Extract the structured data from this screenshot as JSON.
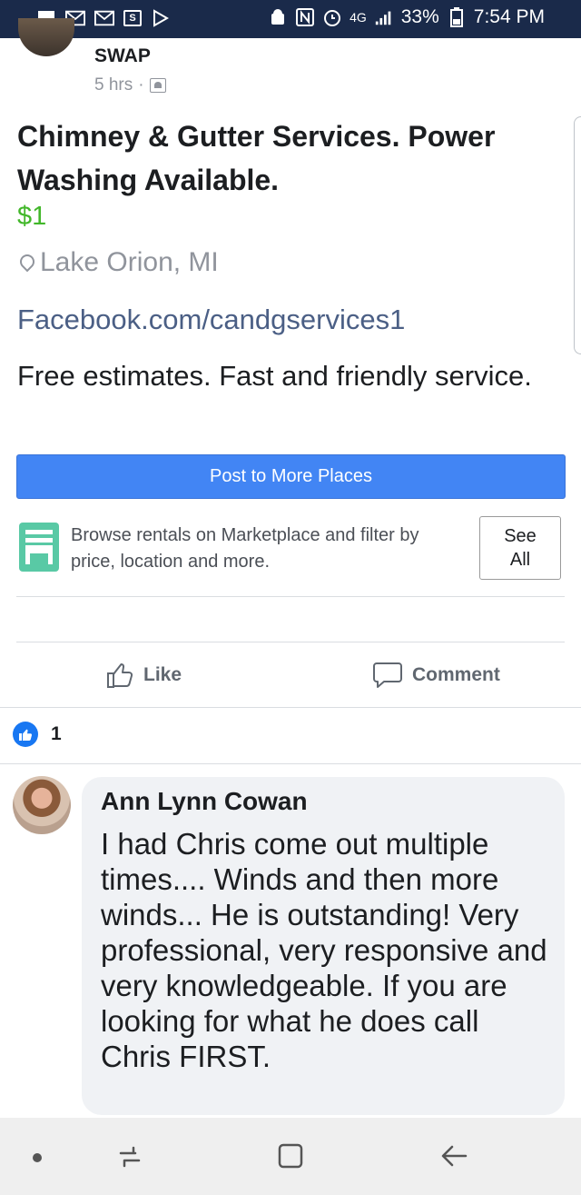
{
  "status_bar": {
    "icons_left": [
      "chat-icon",
      "mail-icon",
      "mail-icon",
      "s-app-icon",
      "play-icon"
    ],
    "icons_right": [
      "android-icon",
      "nfc-icon",
      "alarm-icon",
      "signal-icon"
    ],
    "network": "4G",
    "battery": "33%",
    "time": "7:54 PM"
  },
  "post": {
    "group_name": "SWAP",
    "time_ago": "5 hrs",
    "title": "Chimney & Gutter Services. Power Washing Available.",
    "price": "$1",
    "location": "Lake Orion, MI",
    "link": "Facebook.com/candgservices1",
    "description": "Free estimates. Fast and friendly service.",
    "post_button": "Post to More Places"
  },
  "marketplace_promo": {
    "text": "Browse rentals on Marketplace and filter by price, location and more.",
    "see_all_line1": "See",
    "see_all_line2": "All"
  },
  "actions": {
    "like": "Like",
    "comment": "Comment"
  },
  "reactions": {
    "like_count": "1"
  },
  "comment": {
    "author": "Ann Lynn Cowan",
    "text": "I had Chris come out multiple times.... Winds and then more winds... He is outstanding! Very professional, very responsive and very knowledgeable. If you are looking for what he does call Chris FIRST."
  },
  "colors": {
    "primary_button": "#4285f4",
    "price_green": "#42b72a",
    "marketplace_teal": "#59c9a5",
    "like_blue": "#1877f2",
    "status_bar": "#1a2a4a"
  }
}
